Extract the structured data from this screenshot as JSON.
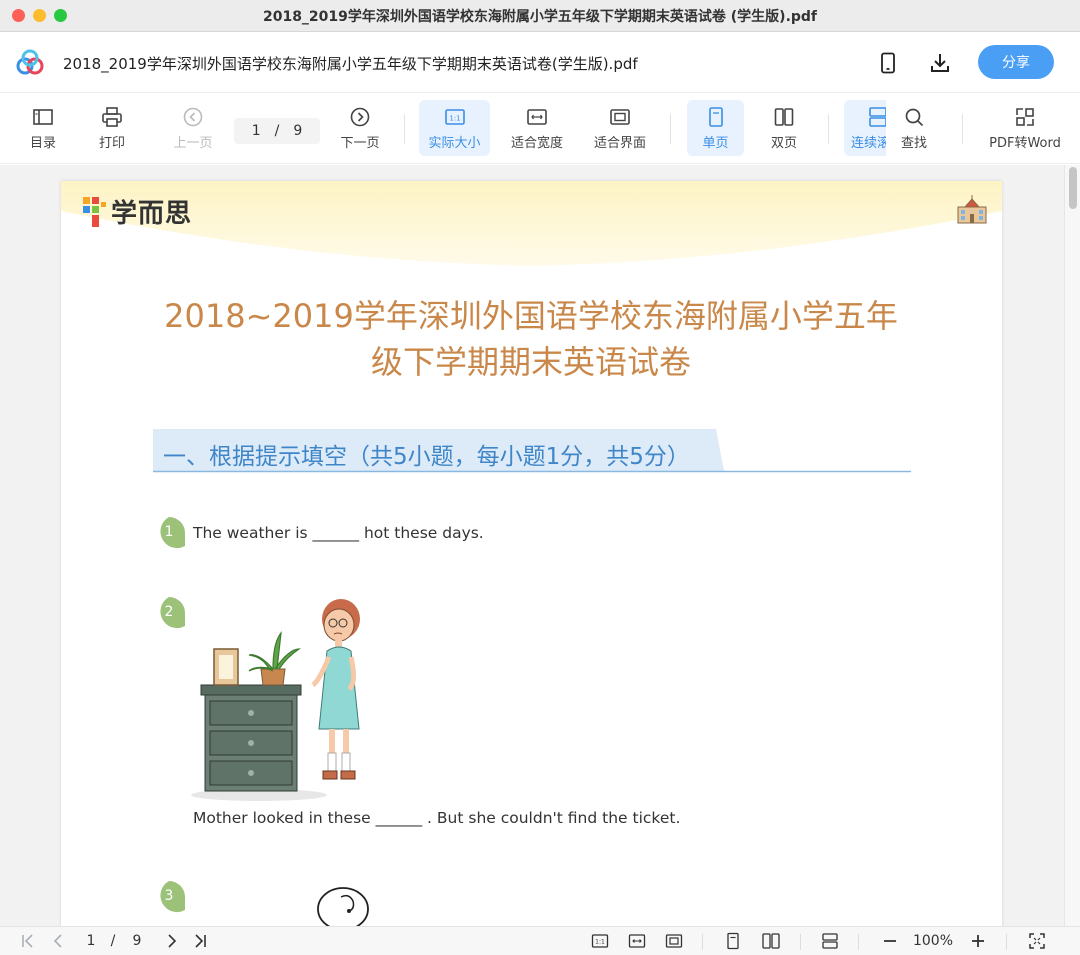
{
  "window": {
    "title": "2018_2019学年深圳外国语学校东海附属小学五年级下学期期末英语试卷 (学生版).pdf"
  },
  "header": {
    "doc_title": "2018_2019学年深圳外国语学校东海附属小学五年级下学期期末英语试卷(学生版).pdf",
    "share_label": "分享",
    "accent_color": "#4a9ff5"
  },
  "toolbar": {
    "toc": "目录",
    "print": "打印",
    "prev_page": "上一页",
    "page_current": "1",
    "page_sep": "/",
    "page_total": "9",
    "next_page": "下一页",
    "actual_size": "实际大小",
    "fit_width": "适合宽度",
    "fit_page": "适合界面",
    "single_page": "单页",
    "double_page": "双页",
    "continuous": "连续滚",
    "find": "查找",
    "pdf_to_word": "PDF转Word"
  },
  "document": {
    "brand": "学而思",
    "title_line1": "2018~2019学年深圳外国语学校东海附属小学五年",
    "title_line2": "级下学期期末英语试卷",
    "section1": "一、根据提示填空（共5小题，每小题1分，共5分）",
    "questions": [
      {
        "num": "1",
        "text": "The weather is ______ hot these days."
      },
      {
        "num": "2",
        "text": "Mother looked in these ______ . But she couldn't find the ticket."
      },
      {
        "num": "3",
        "text": ""
      }
    ]
  },
  "statusbar": {
    "page_current": "1",
    "page_sep": "/",
    "page_total": "9",
    "zoom": "100%"
  }
}
